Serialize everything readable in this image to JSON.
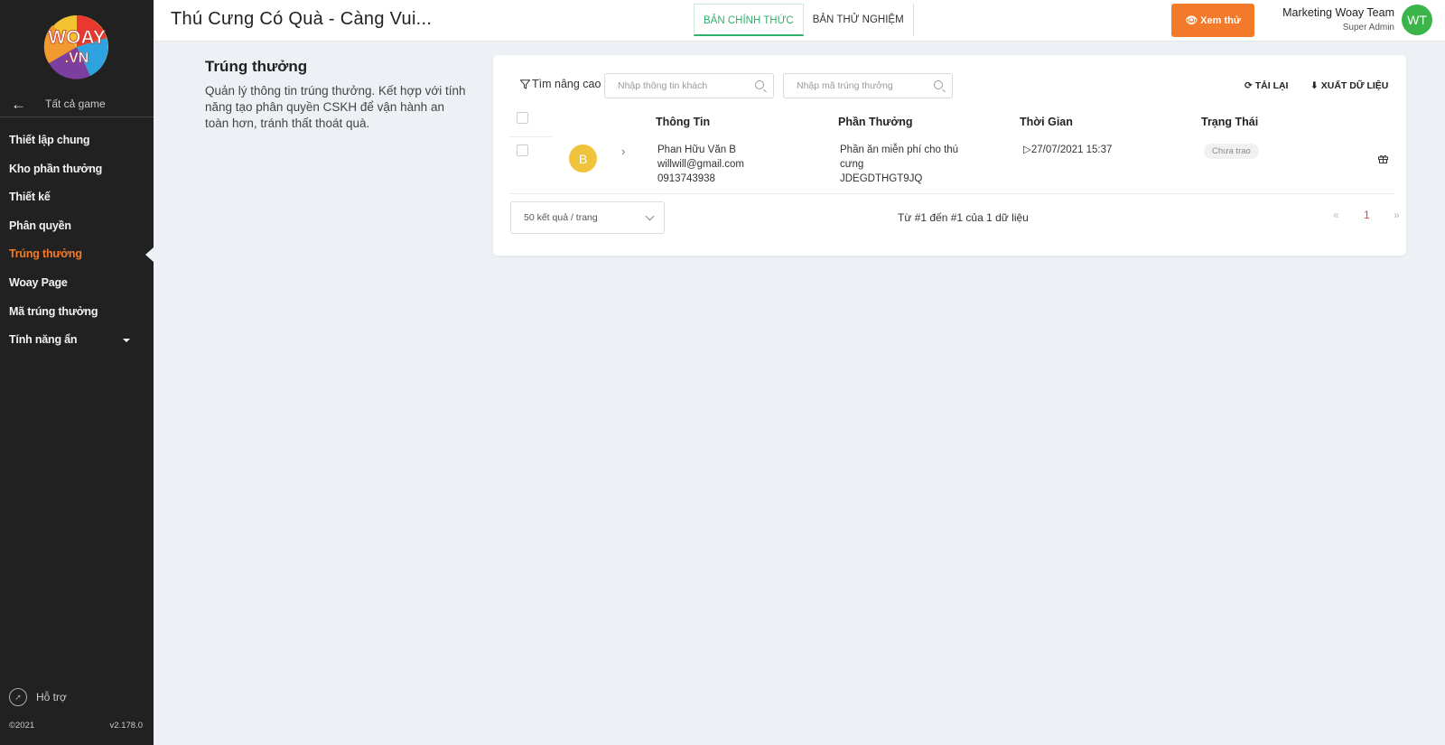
{
  "sidebar": {
    "logo_text": "WOAY .VN",
    "back_label": "Tất cả game",
    "items": [
      {
        "label": "Thiết lập chung"
      },
      {
        "label": "Kho phần thưởng"
      },
      {
        "label": "Thiết kế"
      },
      {
        "label": "Phân quyền"
      },
      {
        "label": "Trúng thưởng",
        "active": true
      },
      {
        "label": "Woay Page"
      },
      {
        "label": "Mã trúng thưởng"
      },
      {
        "label": "Tính năng ẩn"
      }
    ],
    "support_label": "Hỗ trợ",
    "copyright": "©2021",
    "version": "v2.178.0"
  },
  "header": {
    "title": "Thú Cưng Có Quà - Càng Vui...",
    "tabs": [
      {
        "label": "BẢN CHÍNH THỨC",
        "active": true
      },
      {
        "label": "BẢN THỬ NGHIỆM",
        "active": false
      }
    ],
    "preview_label": "Xem thử",
    "user_name": "Marketing Woay Team",
    "user_role": "Super Admin",
    "user_initials": "WT"
  },
  "page": {
    "title": "Trúng thưởng",
    "description": "Quản lý thông tin trúng thưởng. Kết hợp với tính năng tạo phân quyền CSKH để vận hành an toàn hơn, tránh thất thoát quà."
  },
  "toolbar": {
    "filter_label": "Tìm nâng cao",
    "customer_placeholder": "Nhập thông tin khách",
    "code_placeholder": "Nhập mã trúng thưởng",
    "reload_label": "TẢI LẠI",
    "export_label": "XUẤT DỮ LIỆU"
  },
  "table": {
    "columns": [
      "Thông Tin",
      "Phần Thưởng",
      "Thời Gian",
      "Trạng Thái"
    ],
    "rows": [
      {
        "initial": "B",
        "name": "Phan Hữu Văn B",
        "email": "willwill@gmail.com",
        "phone": "0913743938",
        "prize_line1": "Phần ăn miễn phí cho thú",
        "prize_line2": "cưng",
        "code": "JDEGDTHGT9JQ",
        "time": "27/07/2021 15:37",
        "status": "Chưa trao"
      }
    ]
  },
  "pagination": {
    "page_size": "50 kết quả / trang",
    "range_text": "Từ #1 đến #1 của 1 dữ liệu",
    "prev": "«",
    "current": "1",
    "next": "»"
  },
  "colors": {
    "accent": "#f47a2b",
    "active_tab": "#2fb36b",
    "sidebar_bg": "#212121",
    "avatar_user": "#3bb54a",
    "avatar_row": "#f0c33c"
  }
}
